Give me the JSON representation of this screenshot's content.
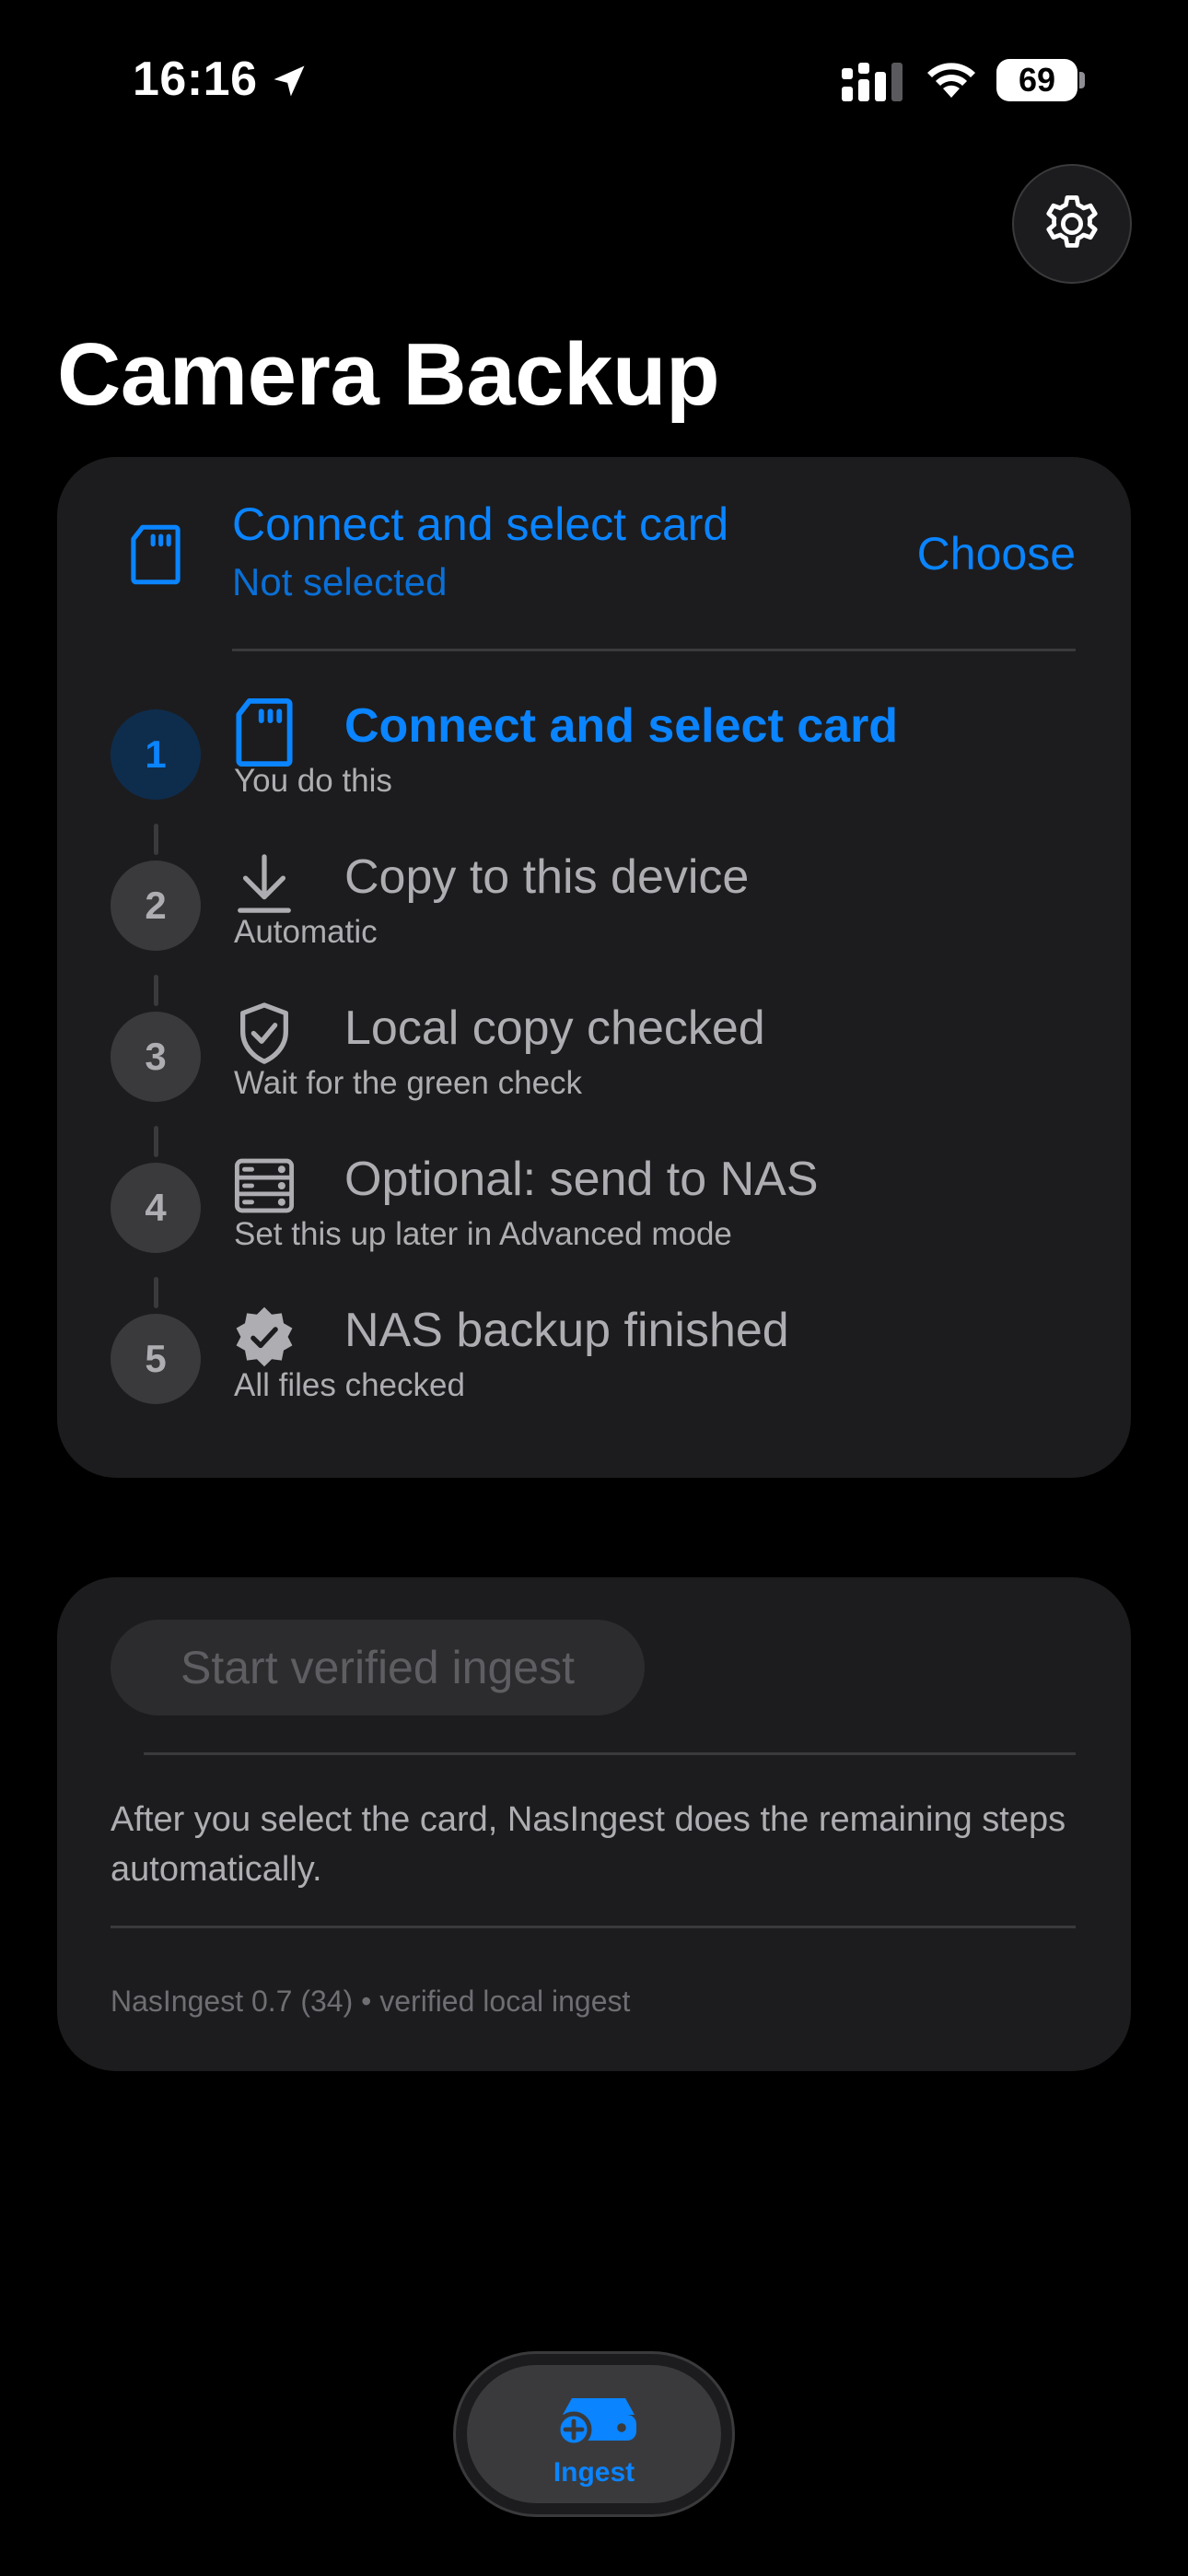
{
  "status_bar": {
    "time": "16:16",
    "battery": "69"
  },
  "page": {
    "title": "Camera Backup"
  },
  "card_selector": {
    "title": "Connect and select card",
    "subtitle": "Not selected",
    "choose_label": "Choose",
    "icon": "sd-card-icon"
  },
  "steps": [
    {
      "number": "1",
      "title": "Connect and select card",
      "subtitle": "You do this",
      "icon": "sd-card-icon",
      "state": "active"
    },
    {
      "number": "2",
      "title": "Copy to this device",
      "subtitle": "Automatic",
      "icon": "download-icon",
      "state": "pending"
    },
    {
      "number": "3",
      "title": "Local copy checked",
      "subtitle": "Wait for the green check",
      "icon": "shield-check-icon",
      "state": "pending"
    },
    {
      "number": "4",
      "title": "Optional: send to NAS",
      "subtitle": "Set this up later in Advanced mode",
      "icon": "server-icon",
      "state": "pending"
    },
    {
      "number": "5",
      "title": "NAS backup finished",
      "subtitle": "All files checked",
      "icon": "verified-badge-icon",
      "state": "pending"
    }
  ],
  "action": {
    "start_label": "Start verified ingest",
    "description": "After you select the card, NasIngest does the remaining steps automatically.",
    "version": "NasIngest 0.7 (34) • verified local ingest"
  },
  "tab_bar": {
    "items": [
      {
        "label": "Ingest",
        "icon": "ingest-drive-icon",
        "selected": true
      }
    ]
  },
  "colors": {
    "accent": "#0a84ff",
    "background": "#000000",
    "card": "#1c1c1e",
    "muted_text": "#aeaeb2"
  }
}
